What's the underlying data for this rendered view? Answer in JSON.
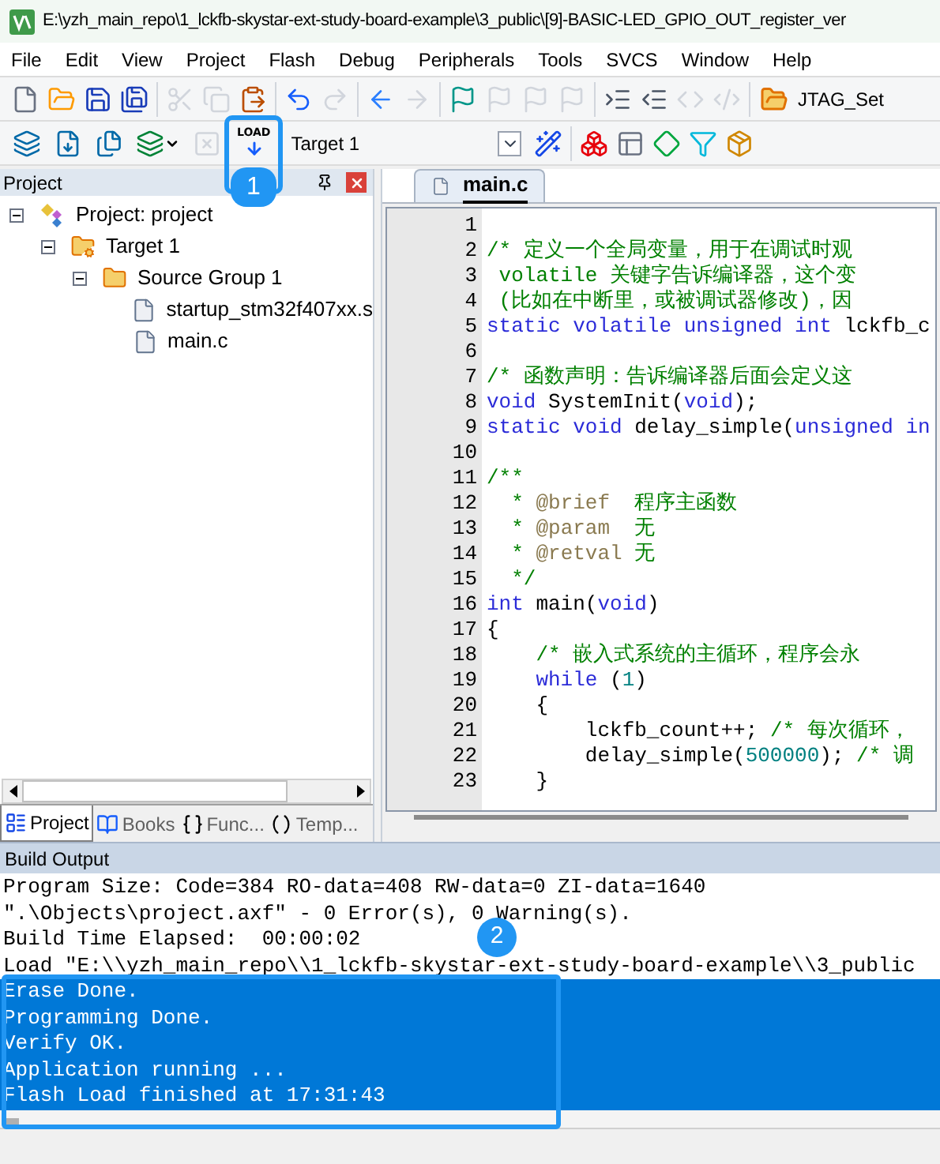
{
  "window": {
    "title": "E:\\yzh_main_repo\\1_lckfb-skystar-ext-study-board-example\\3_public\\[9]-BASIC-LED_GPIO_OUT_register_ver"
  },
  "menu": [
    "File",
    "Edit",
    "View",
    "Project",
    "Flash",
    "Debug",
    "Peripherals",
    "Tools",
    "SVCS",
    "Window",
    "Help"
  ],
  "toolbar_1": {
    "groups": [
      [
        {
          "kind": "new",
          "disabled": false
        },
        {
          "kind": "open",
          "disabled": false
        },
        {
          "kind": "save",
          "disabled": false
        },
        {
          "kind": "save-all",
          "disabled": false
        }
      ],
      [
        {
          "kind": "cut",
          "disabled": true
        },
        {
          "kind": "copy",
          "disabled": true
        },
        {
          "kind": "paste",
          "disabled": false
        }
      ],
      [
        {
          "kind": "undo",
          "disabled": false
        },
        {
          "kind": "redo",
          "disabled": true
        }
      ],
      [
        {
          "kind": "back",
          "disabled": false
        },
        {
          "kind": "forward",
          "disabled": true
        }
      ],
      [
        {
          "kind": "bookmark",
          "disabled": false
        },
        {
          "kind": "prev-bookmark",
          "disabled": true
        },
        {
          "kind": "next-bookmark",
          "disabled": true
        },
        {
          "kind": "clear-bookmarks",
          "disabled": true
        }
      ],
      [
        {
          "kind": "indent",
          "disabled": false
        },
        {
          "kind": "unindent",
          "disabled": false
        },
        {
          "kind": "comment",
          "disabled": true
        },
        {
          "kind": "uncomment",
          "disabled": true
        }
      ]
    ],
    "jtag_button": {
      "label": "JTAG_Set"
    }
  },
  "toolbar_2": {
    "groups": [
      [
        {
          "kind": "translate",
          "disabled": false
        },
        {
          "kind": "build",
          "disabled": false
        },
        {
          "kind": "rebuild",
          "disabled": false
        },
        {
          "kind": "batch",
          "disabled": false
        },
        {
          "kind": "stop",
          "disabled": true
        },
        {
          "kind": "load",
          "label": "LOAD",
          "disabled": false
        }
      ]
    ],
    "target": {
      "value": "Target 1"
    },
    "tools": [
      [
        {
          "kind": "options",
          "disabled": false
        }
      ],
      [
        {
          "kind": "manage",
          "disabled": false
        },
        {
          "kind": "windows",
          "disabled": false
        },
        {
          "kind": "diamond",
          "disabled": false
        },
        {
          "kind": "funnel",
          "disabled": false
        },
        {
          "kind": "pack",
          "disabled": false
        }
      ]
    ]
  },
  "project_panel": {
    "title": "Project",
    "tree": [
      {
        "label": "Project: project",
        "kind": "project",
        "expanded": true,
        "children": [
          {
            "label": "Target 1",
            "kind": "target",
            "expanded": true,
            "children": [
              {
                "label": "Source Group 1",
                "kind": "group",
                "expanded": true,
                "children": [
                  {
                    "label": "startup_stm32f407xx.s",
                    "kind": "file"
                  },
                  {
                    "label": "main.c",
                    "kind": "file"
                  }
                ]
              }
            ]
          }
        ]
      }
    ],
    "tabs": [
      {
        "label": "Project",
        "kind": "project",
        "selected": true
      },
      {
        "label": "Books",
        "kind": "books",
        "selected": false
      },
      {
        "label": "Func...",
        "kind": "functions",
        "selected": false
      },
      {
        "label": "Temp...",
        "kind": "templates",
        "selected": false
      }
    ]
  },
  "editor": {
    "tabs": [
      {
        "label": "main.c",
        "selected": true
      }
    ],
    "lines": [
      {
        "number": "1"
      },
      {
        "number": "2",
        "tokens": [
          {
            "kind": "comment",
            "text": "/* 定义一个全局变量，用于在调试时观"
          }
        ]
      },
      {
        "number": "3",
        "tokens": [
          {
            "kind": "comment",
            "text": " volatile 关键字告诉编译器，这个变"
          }
        ]
      },
      {
        "number": "4",
        "tokens": [
          {
            "kind": "comment",
            "text": " (比如在中断里，或被调试器修改)，因"
          }
        ]
      },
      {
        "number": "5",
        "tokens": [
          {
            "kind": "keyword",
            "text": "static volatile unsigned int"
          },
          {
            "kind": "plain",
            "text": " lckfb_c"
          }
        ]
      },
      {
        "number": "6"
      },
      {
        "number": "7",
        "tokens": [
          {
            "kind": "comment",
            "text": "/* 函数声明：告诉编译器后面会定义这"
          }
        ]
      },
      {
        "number": "8",
        "tokens": [
          {
            "kind": "keyword",
            "text": "void"
          },
          {
            "kind": "plain",
            "text": " SystemInit("
          },
          {
            "kind": "keyword",
            "text": "void"
          },
          {
            "kind": "plain",
            "text": ");"
          }
        ]
      },
      {
        "number": "9",
        "tokens": [
          {
            "kind": "keyword",
            "text": "static void"
          },
          {
            "kind": "plain",
            "text": " delay_simple("
          },
          {
            "kind": "keyword",
            "text": "unsigned in"
          }
        ]
      },
      {
        "number": "10"
      },
      {
        "number": "11",
        "tokens": [
          {
            "kind": "comment",
            "text": "/**"
          }
        ]
      },
      {
        "number": "12",
        "tokens": [
          {
            "kind": "comment",
            "text": "  * "
          },
          {
            "kind": "doctag",
            "text": "@brief"
          },
          {
            "kind": "comment",
            "text": "  程序主函数"
          }
        ]
      },
      {
        "number": "13",
        "tokens": [
          {
            "kind": "comment",
            "text": "  * "
          },
          {
            "kind": "doctag",
            "text": "@param"
          },
          {
            "kind": "comment",
            "text": "  无"
          }
        ]
      },
      {
        "number": "14",
        "tokens": [
          {
            "kind": "comment",
            "text": "  * "
          },
          {
            "kind": "doctag",
            "text": "@retval"
          },
          {
            "kind": "comment",
            "text": " 无"
          }
        ]
      },
      {
        "number": "15",
        "tokens": [
          {
            "kind": "comment",
            "text": "  */"
          }
        ]
      },
      {
        "number": "16",
        "tokens": [
          {
            "kind": "keyword",
            "text": "int"
          },
          {
            "kind": "plain",
            "text": " main("
          },
          {
            "kind": "keyword",
            "text": "void"
          },
          {
            "kind": "plain",
            "text": ")"
          }
        ]
      },
      {
        "number": "17",
        "tokens": [
          {
            "kind": "plain",
            "text": "{"
          }
        ]
      },
      {
        "number": "18",
        "tokens": [
          {
            "kind": "comment",
            "text": "    /* 嵌入式系统的主循环，程序会永"
          }
        ]
      },
      {
        "number": "19",
        "tokens": [
          {
            "kind": "keyword",
            "text": "    while"
          },
          {
            "kind": "plain",
            "text": " ("
          },
          {
            "kind": "number",
            "text": "1"
          },
          {
            "kind": "plain",
            "text": ")"
          }
        ]
      },
      {
        "number": "20",
        "tokens": [
          {
            "kind": "plain",
            "text": "    {"
          }
        ]
      },
      {
        "number": "21",
        "tokens": [
          {
            "kind": "plain",
            "text": "        lckfb_count++; "
          },
          {
            "kind": "comment",
            "text": "/* 每次循环，"
          }
        ]
      },
      {
        "number": "22",
        "tokens": [
          {
            "kind": "plain",
            "text": "        delay_simple("
          },
          {
            "kind": "number",
            "text": "500000"
          },
          {
            "kind": "plain",
            "text": "); "
          },
          {
            "kind": "comment",
            "text": "/* 调"
          }
        ]
      },
      {
        "number": "23",
        "tokens": [
          {
            "kind": "plain",
            "text": "    }"
          }
        ]
      }
    ]
  },
  "build_output": {
    "title": "Build Output",
    "lines": [
      {
        "text": "Program Size: Code=384 RO-data=408 RW-data=0 ZI-data=1640",
        "selected": false
      },
      {
        "text": "\".\\Objects\\project.axf\" - 0 Error(s), 0 Warning(s).",
        "selected": false
      },
      {
        "text": "Build Time Elapsed:  00:00:02",
        "selected": false
      },
      {
        "text": "Load \"E:\\\\yzh_main_repo\\\\1_lckfb-skystar-ext-study-board-example\\\\3_public",
        "selected": false
      },
      {
        "text": "Erase Done.",
        "selected": true
      },
      {
        "text": "Programming Done.",
        "selected": true
      },
      {
        "text": "Verify OK.",
        "selected": true
      },
      {
        "text": "Application running ...",
        "selected": true
      },
      {
        "text": "Flash Load finished at 17:31:43",
        "selected": true
      }
    ]
  },
  "callouts": [
    {
      "label": "1"
    },
    {
      "label": "2"
    }
  ]
}
